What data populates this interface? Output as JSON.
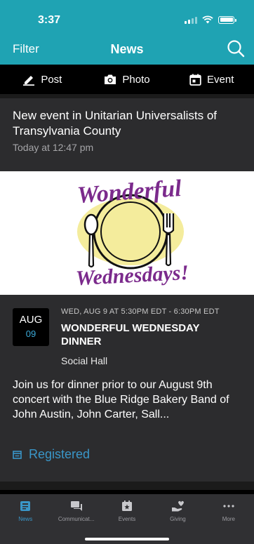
{
  "status_bar": {
    "time": "3:37",
    "signal_bars": 2,
    "battery_level": 1.0
  },
  "nav": {
    "filter_label": "Filter",
    "title": "News"
  },
  "compose": {
    "post": "Post",
    "photo": "Photo",
    "event": "Event"
  },
  "notice": {
    "text": "New event in Unitarian Universalists of Transylvania County",
    "time": "Today at 12:47 pm"
  },
  "banner": {
    "line1": "Wonderful",
    "line2": "Wednesdays!"
  },
  "event": {
    "month": "AUG",
    "day": "09",
    "when": "WED, AUG 9 AT 5:30PM EDT - 6:30PM EDT",
    "title": "WONDERFUL WEDNESDAY DINNER",
    "location": "Social Hall",
    "description": "Join us for dinner prior to our August 9th concert with the Blue Ridge Bakery Band of John Austin, John Carter, Sall...",
    "status": "Registered"
  },
  "tabs": [
    {
      "label": "News",
      "icon": "news-icon",
      "active": true
    },
    {
      "label": "Communicat...",
      "icon": "chat-icon",
      "active": false
    },
    {
      "label": "Events",
      "icon": "calendar-star-icon",
      "active": false
    },
    {
      "label": "Giving",
      "icon": "giving-hand-icon",
      "active": false
    },
    {
      "label": "More",
      "icon": "more-dots-icon",
      "active": false
    }
  ],
  "colors": {
    "header": "#1fa3b3",
    "accent": "#3a96c8",
    "banner_purple": "#7b2a8c",
    "plate_yellow": "#f4ec9c"
  }
}
